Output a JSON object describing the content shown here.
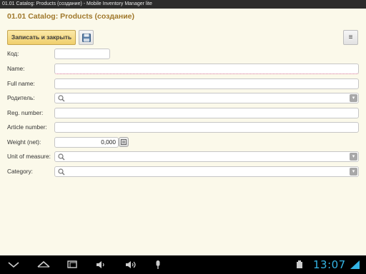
{
  "window": {
    "title": "01.01 Catalog: Products (создание) - Mobile Inventory Manager lite"
  },
  "page": {
    "title": "01.01 Catalog: Products (создание)"
  },
  "toolbar": {
    "save_and_close_label": "Записать и закрыть",
    "save_icon": "floppy-disk-icon",
    "menu_icon": "menu-lines-icon"
  },
  "form": {
    "code": {
      "label": "Код:",
      "value": ""
    },
    "name": {
      "label": "Name:",
      "value": ""
    },
    "full_name": {
      "label": "Full name:",
      "value": ""
    },
    "parent": {
      "label": "Родитель:",
      "value": ""
    },
    "reg_number": {
      "label": "Reg. number:",
      "value": ""
    },
    "article_number": {
      "label": "Article number:",
      "value": ""
    },
    "weight_net": {
      "label": "Weight (net):",
      "value": "0,000"
    },
    "unit_of_measure": {
      "label": "Unit of measure:",
      "value": ""
    },
    "category": {
      "label": "Category:",
      "value": ""
    }
  },
  "status_bar": {
    "time": "13:07"
  },
  "colors": {
    "title": "#a0782b",
    "background": "#fbf9ea",
    "button_primary": "#f0cf6c",
    "clock": "#34b4e4"
  }
}
